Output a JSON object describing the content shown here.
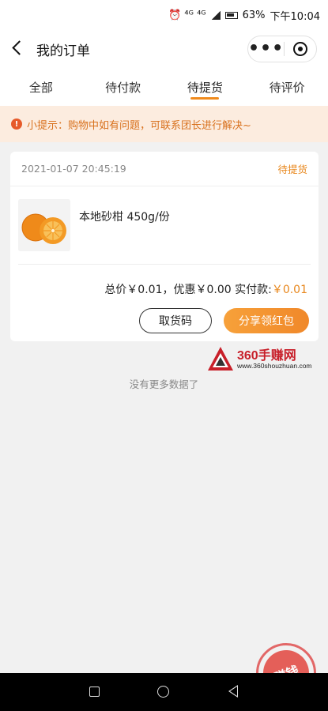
{
  "status_bar": {
    "indicators": "⏰ ⁴ᴳ ⁴ᴳ",
    "battery": "63%",
    "time": "下午10:04"
  },
  "nav": {
    "title": "我的订单",
    "more_icon": "•••"
  },
  "tabs": [
    {
      "label": "全部",
      "active": false
    },
    {
      "label": "待付款",
      "active": false
    },
    {
      "label": "待提货",
      "active": true
    },
    {
      "label": "待评价",
      "active": false
    }
  ],
  "notice": {
    "text": "小提示：购物中如有问题，可联系团长进行解决~"
  },
  "order": {
    "time": "2021-01-07 20:45:19",
    "status": "待提货",
    "product_name": "本地砂柑 450g/份",
    "summary_prefix": "总价￥0.01，优惠￥0.00  实付款:",
    "paid": "￥0.01",
    "btn_pickup_code": "取货码",
    "btn_share": "分享领红包"
  },
  "watermark": {
    "title": "360手赚网",
    "url": "www.360shouzhuan.com"
  },
  "list_end": "没有更多数据了",
  "stamp": {
    "text": "赚钱"
  },
  "colors": {
    "accent": "#e8871c",
    "notice_bg": "#fcecdf",
    "page_bg": "#f1f1f1"
  }
}
